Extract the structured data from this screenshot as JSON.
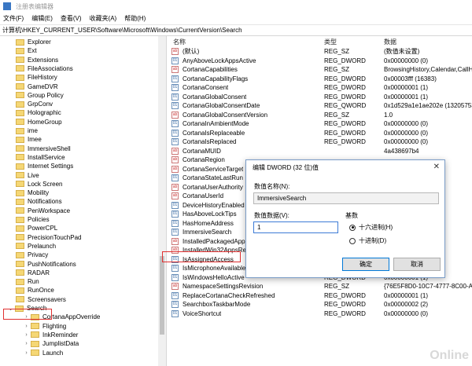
{
  "window": {
    "title": "注册表编辑器"
  },
  "menu": [
    "文件(F)",
    "编辑(E)",
    "查看(V)",
    "收藏夹(A)",
    "帮助(H)"
  ],
  "address": "计算机\\HKEY_CURRENT_USER\\Software\\Microsoft\\Windows\\CurrentVersion\\Search",
  "tree": [
    {
      "label": "Explorer"
    },
    {
      "label": "Ext"
    },
    {
      "label": "Extensions"
    },
    {
      "label": "FileAssociations"
    },
    {
      "label": "FileHistory"
    },
    {
      "label": "GameDVR"
    },
    {
      "label": "Group Policy"
    },
    {
      "label": "GrpConv"
    },
    {
      "label": "Holographic"
    },
    {
      "label": "HomeGroup"
    },
    {
      "label": "ime"
    },
    {
      "label": "Imee"
    },
    {
      "label": "ImmersiveShell"
    },
    {
      "label": "InstallService"
    },
    {
      "label": "Internet Settings"
    },
    {
      "label": "Live"
    },
    {
      "label": "Lock Screen"
    },
    {
      "label": "Mobility"
    },
    {
      "label": "Notifications"
    },
    {
      "label": "PenWorkspace"
    },
    {
      "label": "Policies"
    },
    {
      "label": "PowerCPL"
    },
    {
      "label": "PrecisionTouchPad"
    },
    {
      "label": "Prelaunch"
    },
    {
      "label": "Privacy"
    },
    {
      "label": "PushNotifications"
    },
    {
      "label": "RADAR"
    },
    {
      "label": "Run"
    },
    {
      "label": "RunOnce"
    },
    {
      "label": "Screensavers"
    },
    {
      "label": "Search"
    },
    {
      "label": "CortanaAppOverride"
    },
    {
      "label": "Flighting"
    },
    {
      "label": "InkReminder"
    },
    {
      "label": "JumplistData"
    },
    {
      "label": "Launch"
    }
  ],
  "columns": {
    "name": "名称",
    "type": "类型",
    "data": "数据"
  },
  "values": [
    {
      "name": "(默认)",
      "type": "REG_SZ",
      "data": "(数值未设置)",
      "icon": "ab"
    },
    {
      "name": "AnyAboveLockAppsActive",
      "type": "REG_DWORD",
      "data": "0x00000000 (0)",
      "icon": "dw"
    },
    {
      "name": "CortanaCapabilities",
      "type": "REG_SZ",
      "data": "BrowsingHistory,Calendar,CallHi",
      "icon": "ab"
    },
    {
      "name": "CortanaCapabilityFlags",
      "type": "REG_DWORD",
      "data": "0x00003fff (16383)",
      "icon": "dw"
    },
    {
      "name": "CortanaConsent",
      "type": "REG_DWORD",
      "data": "0x00000001 (1)",
      "icon": "dw"
    },
    {
      "name": "CortanaGlobalConsent",
      "type": "REG_DWORD",
      "data": "0x00000001 (1)",
      "icon": "dw"
    },
    {
      "name": "CortanaGlobalConsentDate",
      "type": "REG_QWORD",
      "data": "0x1d529a1e1ae202e (13205753931",
      "icon": "dw"
    },
    {
      "name": "CortanaGlobalConsentVersion",
      "type": "REG_SZ",
      "data": "1.0",
      "icon": "ab"
    },
    {
      "name": "CortanaInAmbientMode",
      "type": "REG_DWORD",
      "data": "0x00000000 (0)",
      "icon": "dw"
    },
    {
      "name": "CortanaIsReplaceable",
      "type": "REG_DWORD",
      "data": "0x00000000 (0)",
      "icon": "dw"
    },
    {
      "name": "CortanaIsReplaced",
      "type": "REG_DWORD",
      "data": "0x00000000 (0)",
      "icon": "dw"
    },
    {
      "name": "CortanaMUID",
      "type": "",
      "data": "4a438697b4",
      "icon": "ab"
    },
    {
      "name": "CortanaRegion",
      "type": "",
      "data": "",
      "icon": "ab"
    },
    {
      "name": "CortanaServiceTarget",
      "type": "",
      "data": "",
      "icon": "ab"
    },
    {
      "name": "CortanaStateLastRun",
      "type": "",
      "data": "",
      "icon": "dw"
    },
    {
      "name": "CortanaUserAuthority",
      "type": "",
      "data": "",
      "icon": "ab"
    },
    {
      "name": "CortanaUserId",
      "type": "",
      "data": "",
      "icon": "ab"
    },
    {
      "name": "DeviceHistoryEnabled",
      "type": "",
      "data": "",
      "icon": "dw"
    },
    {
      "name": "HasAboveLockTips",
      "type": "",
      "data": "",
      "icon": "dw"
    },
    {
      "name": "HasHomeAddress",
      "type": "",
      "data": "",
      "icon": "dw"
    },
    {
      "name": "ImmersiveSearch",
      "type": "",
      "data": "",
      "icon": "dw"
    },
    {
      "name": "InstalledPackagedAppsRe",
      "type": "",
      "data": "-898E-210F",
      "icon": "ab"
    },
    {
      "name": "InstalledWin32AppsRevisi",
      "type": "",
      "data": "-E19E-94C",
      "icon": "ab"
    },
    {
      "name": "IsAssignedAccess",
      "type": "REG_DWORD",
      "data": "0x00000000 (0)",
      "icon": "dw"
    },
    {
      "name": "IsMicrophoneAvailable",
      "type": "REG_DWORD",
      "data": "0x00000001 (1)",
      "icon": "dw"
    },
    {
      "name": "IsWindowsHelloActive",
      "type": "REG_DWORD",
      "data": "0x00000001 (1)",
      "icon": "dw"
    },
    {
      "name": "NamespaceSettingsRevision",
      "type": "REG_SZ",
      "data": "{76E5F8D0-10C7-4777-8C00-AA0",
      "icon": "ab"
    },
    {
      "name": "ReplaceCortanaCheckRefreshed",
      "type": "REG_DWORD",
      "data": "0x00000001 (1)",
      "icon": "dw"
    },
    {
      "name": "SearchboxTaskbarMode",
      "type": "REG_DWORD",
      "data": "0x00000002 (2)",
      "icon": "dw"
    },
    {
      "name": "VoiceShortcut",
      "type": "REG_DWORD",
      "data": "0x00000000 (0)",
      "icon": "dw"
    }
  ],
  "dialog": {
    "title": "编辑 DWORD (32 位)值",
    "name_label": "数值名称(N):",
    "name_value": "ImmersiveSearch",
    "data_label": "数值数据(V):",
    "data_value": "1",
    "base_label": "基数",
    "hex_label": "十六进制(H)",
    "dec_label": "十进制(D)",
    "selected_base": "hex",
    "ok": "确定",
    "cancel": "取消"
  },
  "watermark": "Online"
}
